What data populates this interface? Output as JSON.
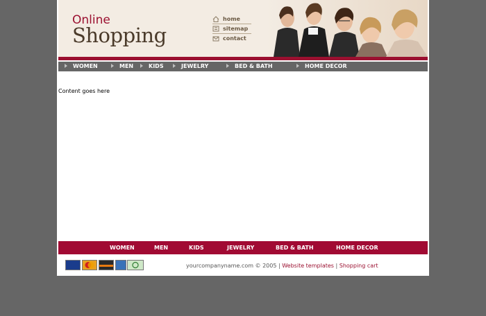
{
  "header": {
    "logo_line1": "Online",
    "logo_line2": "Shopping",
    "links": [
      {
        "label": "home",
        "icon": "home-icon"
      },
      {
        "label": "sitemap",
        "icon": "sitemap-icon"
      },
      {
        "label": "contact",
        "icon": "mail-icon"
      }
    ]
  },
  "nav": {
    "items": [
      "WOMEN",
      "MEN",
      "KIDS",
      "JEWELRY",
      "BED & BATH",
      "HOME DECOR"
    ]
  },
  "main": {
    "content_text": "Content goes here"
  },
  "footer": {
    "nav_items": [
      "WOMEN",
      "MEN",
      "KIDS",
      "JEWELRY",
      "BED & BATH",
      "HOME DECOR"
    ],
    "payment_cards": [
      "visa-card-icon",
      "mastercard-icon",
      "discover-card-icon",
      "amex-card-icon",
      "echeck-icon"
    ],
    "copyright_text": "yourcompanyname.com © 2005 |",
    "link_templates": "Website templates",
    "separator": "|",
    "link_cart": "Shopping cart"
  },
  "colors": {
    "brand_red": "#9b1030",
    "footer_red": "#a10a33",
    "background_gray": "#666666",
    "header_bg": "#f3ece3"
  }
}
